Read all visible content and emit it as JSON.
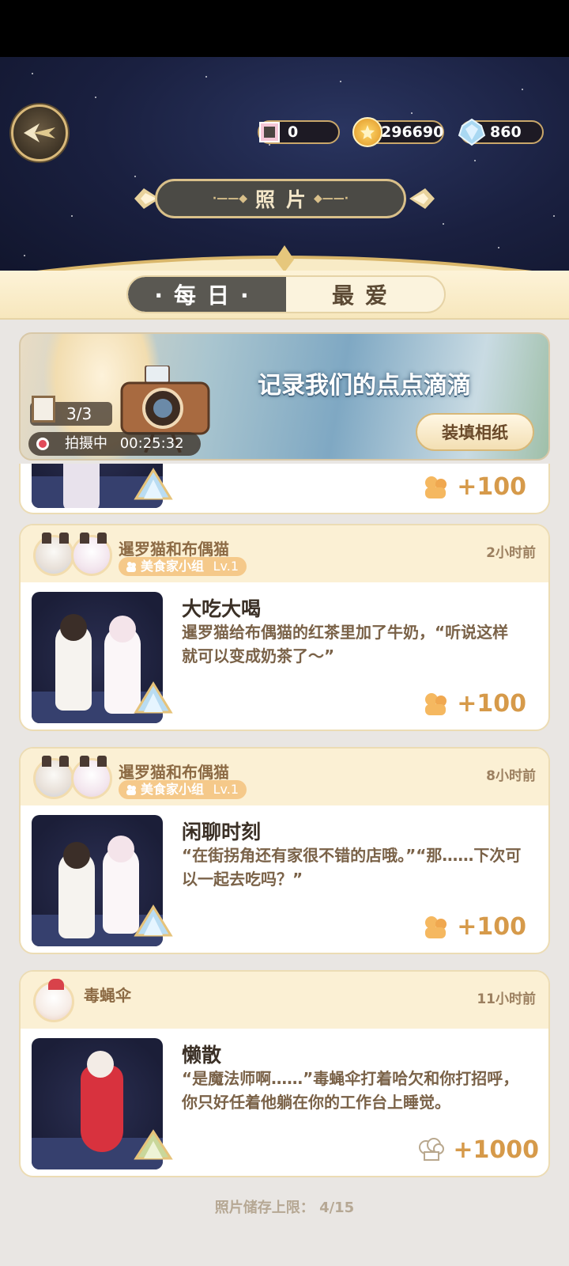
{
  "header": {
    "title": "照片",
    "currencies": [
      {
        "icon": "film-icon",
        "value": "0"
      },
      {
        "icon": "gold-coin-icon",
        "value": "296690"
      },
      {
        "icon": "diamond-icon",
        "value": "860"
      }
    ]
  },
  "tabs": [
    {
      "label": "·每日·",
      "active": true
    },
    {
      "label": "最爱",
      "active": false
    }
  ],
  "banner": {
    "title": "记录我们的点点滴滴",
    "counter": "3/3",
    "shooting_label": "拍摄中",
    "shooting_timer": "00:25:32",
    "load_button": "装填相纸"
  },
  "partial_entry": {
    "reward": "+100"
  },
  "entries": [
    {
      "names": "暹罗猫和布偶猫",
      "group": "美食家小组",
      "group_level": "Lv.1",
      "time": "2小时前",
      "title": "大吃大喝",
      "text": "暹罗猫给布偶猫的红茶里加了牛奶，“听说这样就可以变成奶茶了～”",
      "reward": "+100"
    },
    {
      "names": "暹罗猫和布偶猫",
      "group": "美食家小组",
      "group_level": "Lv.1",
      "time": "8小时前",
      "title": "闲聊时刻",
      "text": "“在街拐角还有家很不错的店哦。”“那……下次可以一起去吃吗？”",
      "reward": "+100"
    },
    {
      "names": "毒蝇伞",
      "time": "11小时前",
      "title": "懒散",
      "text": "“是魔法师啊……”毒蝇伞打着哈欠和你打招呼，你只好任着他躺在你的工作台上睡觉。",
      "reward": "+1000"
    }
  ],
  "footer": {
    "storage_label": "照片储存上限：",
    "storage_value": "4/15"
  },
  "colors": {
    "gold_border": "#d9c08a",
    "card_head": "#fbf0d4",
    "reward": "#d69a4a"
  }
}
